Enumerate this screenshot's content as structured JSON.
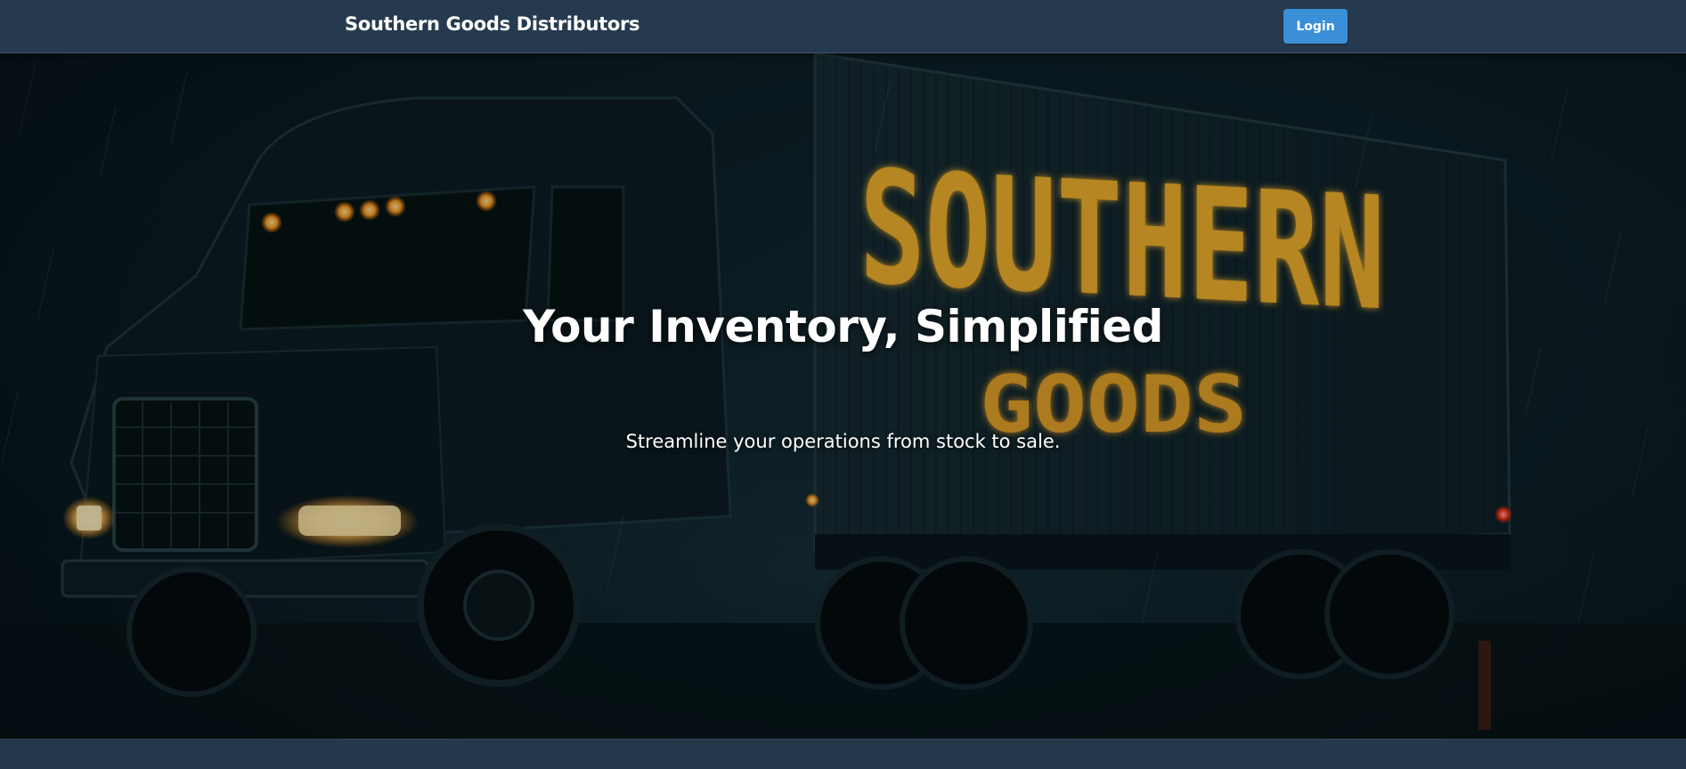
{
  "navbar": {
    "brand": "Southern Goods Distributors",
    "login_label": "Login"
  },
  "hero": {
    "title": "Your Inventory, Simplified",
    "subtitle": "Streamline your operations from stock to sale.",
    "image_sign_text_line1": "SOUTHERN",
    "image_sign_text_line2": "GOODS"
  },
  "colors": {
    "navbar_bg": "#263a4f",
    "login_button_bg": "#3b8fd6",
    "hero_text": "#ffffff",
    "sign_glow": "#f2b02a"
  }
}
